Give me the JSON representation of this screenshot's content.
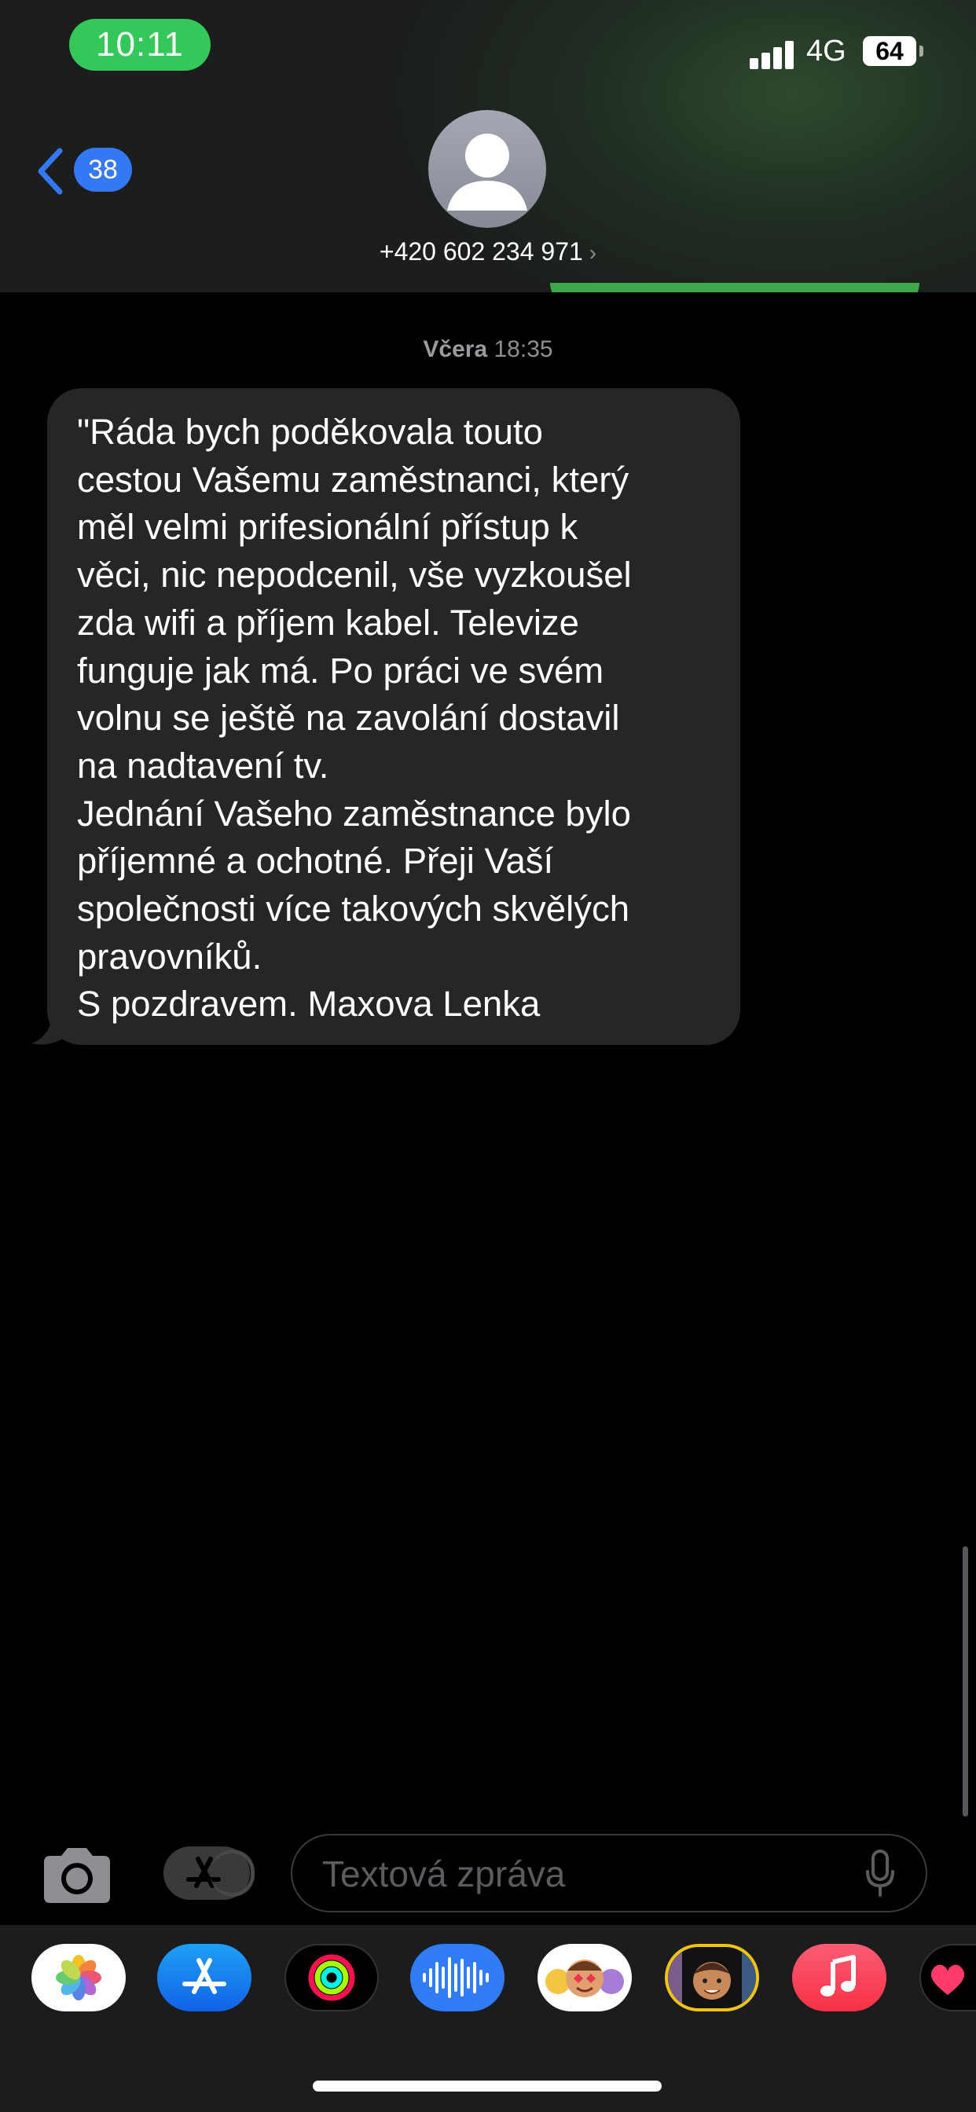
{
  "status_bar": {
    "time": "10:11",
    "network": "4G",
    "battery": "64",
    "accent_color": "#34c759"
  },
  "header": {
    "back_badge": "38",
    "contact": "+420 602 234 971",
    "chevron": "›"
  },
  "thread": {
    "timestamp_day": "Včera",
    "timestamp_time": "18:35",
    "message_lines": [
      "\"Ráda bych poděkovala touto",
      "cestou Vašemu zaměstnanci, který",
      "měl velmi prifesionální přístup k",
      "věci, nic nepodcenil, vše vyzkoušel",
      "zda wifi a příjem kabel. Televize",
      "funguje jak má. Po práci ve svém",
      "volnu se ještě na zavolání dostavil",
      "na nadtavení tv.",
      "Jednání Vašeho zaměstnance bylo",
      "příjemné a ochotné. Přeji Vaší",
      "společnosti více takových skvělých",
      "pravovníků.",
      "S pozdravem. Maxova Lenka"
    ]
  },
  "composer": {
    "placeholder": "Textová zpráva",
    "icons": [
      "camera-icon",
      "app-store-apps-icon",
      "microphone-icon"
    ]
  },
  "app_strip": [
    "photos",
    "app-store",
    "activity",
    "audio-message",
    "memoji-stickers",
    "memoji",
    "music",
    "hearts"
  ]
}
